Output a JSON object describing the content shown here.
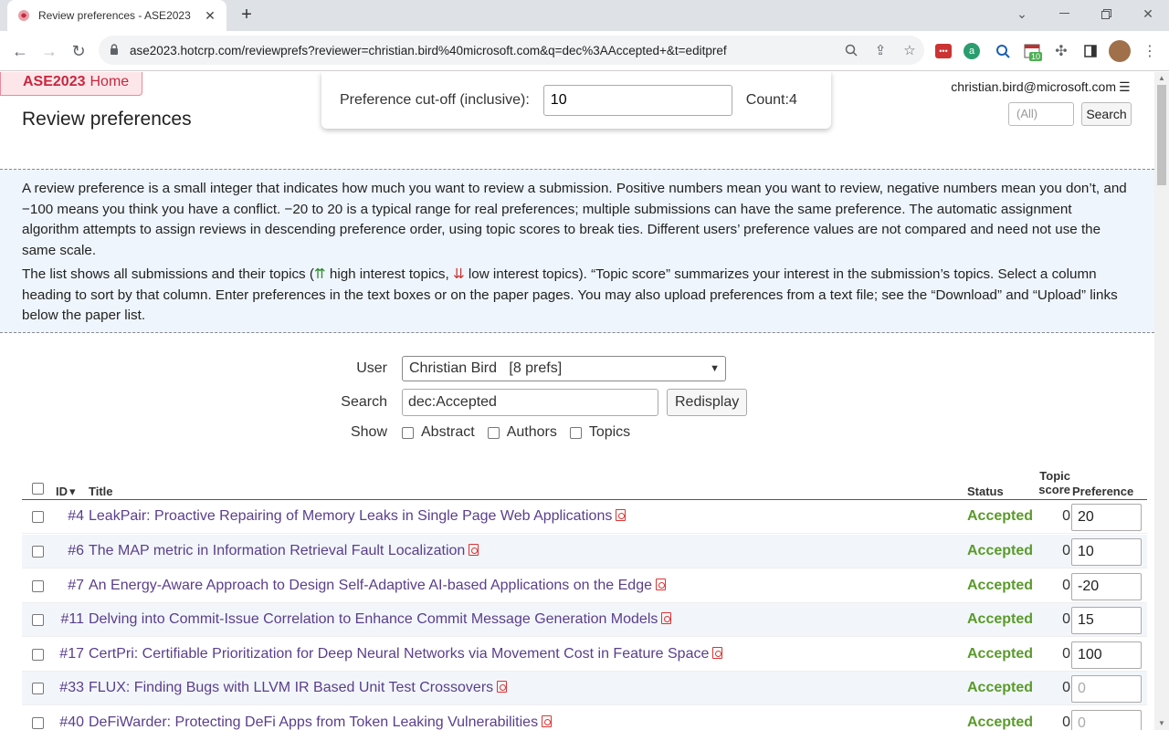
{
  "browser": {
    "tab_title": "Review preferences - ASE2023",
    "url": "ase2023.hotcrp.com/reviewprefs?reviewer=christian.bird%40microsoft.com&q=dec%3AAccepted+&t=editpref",
    "ext_badge": "10"
  },
  "header": {
    "home_conf": "ASE2023",
    "home_label": "Home",
    "page_title": "Review preferences",
    "user_email": "christian.bird@microsoft.com",
    "menu_icon": "☰",
    "quicksearch_placeholder": "(All)",
    "quicksearch_button": "Search"
  },
  "cutoff": {
    "label": "Preference cut-off (inclusive):",
    "value": "10",
    "count_label": "Count:4"
  },
  "info": {
    "p1": "A review preference is a small integer that indicates how much you want to review a submission. Positive numbers mean you want to review, negative numbers mean you don’t, and −100 means you think you have a conflict. −20 to 20 is a typical range for real preferences; multiple submissions can have the same preference. The automatic assignment algorithm attempts to assign reviews in descending preference order, using topic scores to break ties. Different users’ preference values are not compared and need not use the same scale.",
    "p2_a": "The list shows all submissions and their topics (",
    "p2_up": "⇈",
    "p2_b": " high interest topics, ",
    "p2_down": "⇊",
    "p2_c": " low interest topics). “Topic score” summarizes your interest in the submission’s topics. Select a column heading to sort by that column. Enter preferences in the text boxes or on the paper pages. You may also upload preferences from a text file; see the “Download” and “Upload” links below the paper list."
  },
  "form": {
    "user_label": "User",
    "user_value": "Christian Bird   [8 prefs]",
    "search_label": "Search",
    "search_value": "dec:Accepted",
    "redisplay_label": "Redisplay",
    "show_label": "Show",
    "show_options": [
      "Abstract",
      "Authors",
      "Topics"
    ]
  },
  "table": {
    "headers": {
      "id": "ID",
      "sort_indicator": "▾",
      "title": "Title",
      "status": "Status",
      "topic_score_1": "Topic",
      "topic_score_2": "score",
      "preference": "Preference"
    },
    "rows": [
      {
        "id": "#4",
        "title": "LeakPair: Proactive Repairing of Memory Leaks in Single Page Web Applications",
        "status": "Accepted",
        "topic_score": "0",
        "preference": "20"
      },
      {
        "id": "#6",
        "title": "The MAP metric in Information Retrieval Fault Localization",
        "status": "Accepted",
        "topic_score": "0",
        "preference": "10"
      },
      {
        "id": "#7",
        "title": "An Energy-Aware Approach to Design Self-Adaptive AI-based Applications on the Edge",
        "status": "Accepted",
        "topic_score": "0",
        "preference": "-20"
      },
      {
        "id": "#11",
        "title": "Delving into Commit-Issue Correlation to Enhance Commit Message Generation Models",
        "status": "Accepted",
        "topic_score": "0",
        "preference": "15"
      },
      {
        "id": "#17",
        "title": "CertPri: Certifiable Prioritization for Deep Neural Networks via Movement Cost in Feature Space",
        "status": "Accepted",
        "topic_score": "0",
        "preference": "100"
      },
      {
        "id": "#33",
        "title": "FLUX: Finding Bugs with LLVM IR Based Unit Test Crossovers",
        "status": "Accepted",
        "topic_score": "0",
        "preference": "0"
      },
      {
        "id": "#40",
        "title": "DeFiWarder: Protecting DeFi Apps from Token Leaking Vulnerabilities",
        "status": "Accepted",
        "topic_score": "0",
        "preference": "0"
      }
    ]
  },
  "colors": {
    "accent_red": "#c7273d",
    "link_purple": "#5a3e8c",
    "status_green": "#5a9b2b",
    "info_bg": "#eef5fc"
  }
}
